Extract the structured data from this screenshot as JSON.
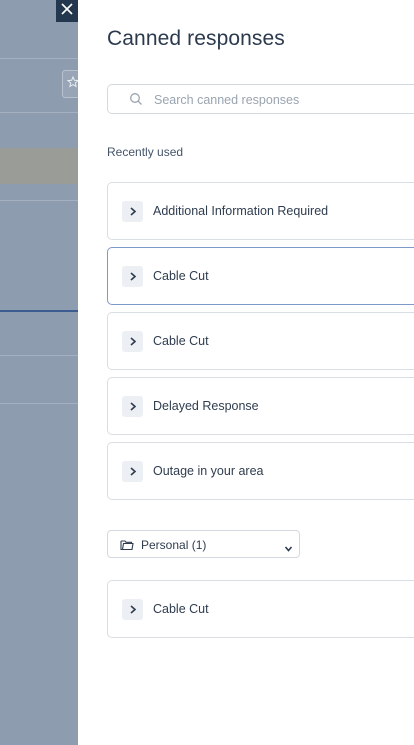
{
  "panel": {
    "title": "Canned responses",
    "search": {
      "placeholder": "Search canned responses",
      "value": ""
    },
    "recent_label": "Recently used",
    "recent_items": [
      {
        "label": "Additional Information Required"
      },
      {
        "label": "Cable Cut"
      },
      {
        "label": "Cable Cut"
      },
      {
        "label": "Delayed Response"
      },
      {
        "label": "Outage in your area"
      }
    ],
    "folder_select": {
      "selected": "Personal (1)"
    },
    "personal_items": [
      {
        "label": "Cable Cut"
      }
    ]
  },
  "icons": {
    "close": "close-icon",
    "search": "search-icon",
    "chevron": "chevron-right-icon",
    "folder": "folder-icon",
    "dropdown": "chevron-down-icon",
    "star": "star-icon"
  },
  "colors": {
    "title": "#2b3a4d",
    "active_border": "#7d99c9",
    "overlay": "#8d9cae",
    "close_bg": "#23384f"
  }
}
